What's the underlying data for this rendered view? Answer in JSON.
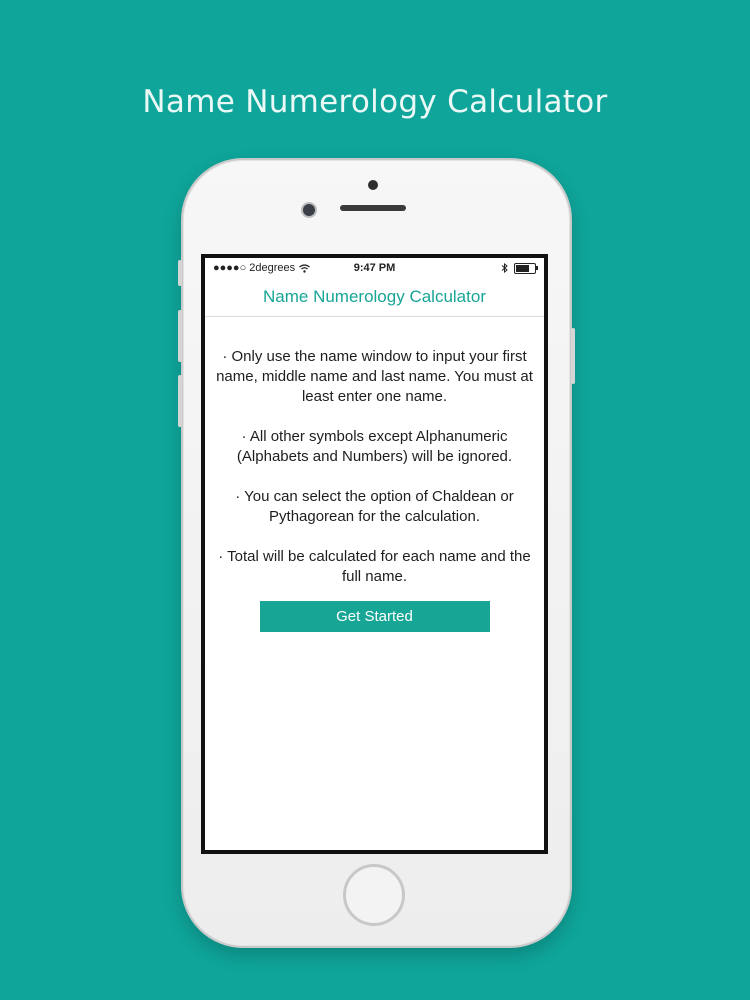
{
  "promo": {
    "title": "Name Numerology Calculator"
  },
  "status_bar": {
    "carrier": "●●●●○ 2degrees",
    "time": "9:47 PM",
    "wifi_icon": "wifi-icon",
    "bluetooth_icon": "bluetooth-icon",
    "battery_level": 0.7
  },
  "app": {
    "nav_title": "Name Numerology Calculator",
    "instructions": [
      "· Only use the name window to input your first name, middle name and last name. You must at least enter one name.",
      "· All other symbols except Alphanumeric (Alphabets and Numbers) will be ignored.",
      "· You can select the option of Chaldean or Pythagorean for the calculation.",
      "· Total will be calculated for each name and the full name."
    ],
    "get_started_label": "Get Started"
  },
  "colors": {
    "background": "#0fa59a",
    "accent": "#17a596"
  }
}
